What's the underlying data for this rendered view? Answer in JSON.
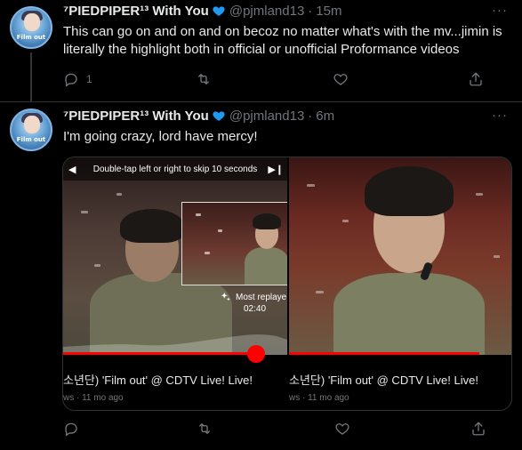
{
  "tweets": [
    {
      "avatar_text": "Film out",
      "name": "⁷PIEDPIPER¹³ With You",
      "handle": "@pjmland13",
      "time": "15m",
      "text": "This can go on and on and on becoz no matter what's with the mv...jimin is literally the highlight both in official or unofficial Proformance videos",
      "reply_count": "1"
    },
    {
      "avatar_text": "Film out",
      "name": "⁷PIEDPIPER¹³ With You",
      "handle": "@pjmland13",
      "time": "6m",
      "text": "I'm going crazy, lord have mercy!",
      "reply_count": ""
    }
  ],
  "media": {
    "skip_hint": "Double-tap left or right to skip 10 seconds",
    "most_replayed": "Most replaye",
    "timestamp": "02:40",
    "left_title": "소년단) 'Film out' @ CDTV Live! Live!",
    "left_sub": "ws · 11 mo ago",
    "right_title": "소년단) 'Film out' @ CDTV Live! Live!",
    "right_sub": "ws · 11 mo ago",
    "left_progress": 0.86,
    "right_progress": 0.85
  },
  "colors": {
    "background": "#000000",
    "text": "#e7e9ea",
    "muted": "#71767b",
    "heart": "#1d9bf0",
    "progress": "#ff0000"
  },
  "icons": [
    "heart-icon",
    "more-icon",
    "reply-icon",
    "retweet-icon",
    "like-icon",
    "share-icon",
    "sparkle-icon",
    "play-prev-icon",
    "play-next-icon"
  ]
}
